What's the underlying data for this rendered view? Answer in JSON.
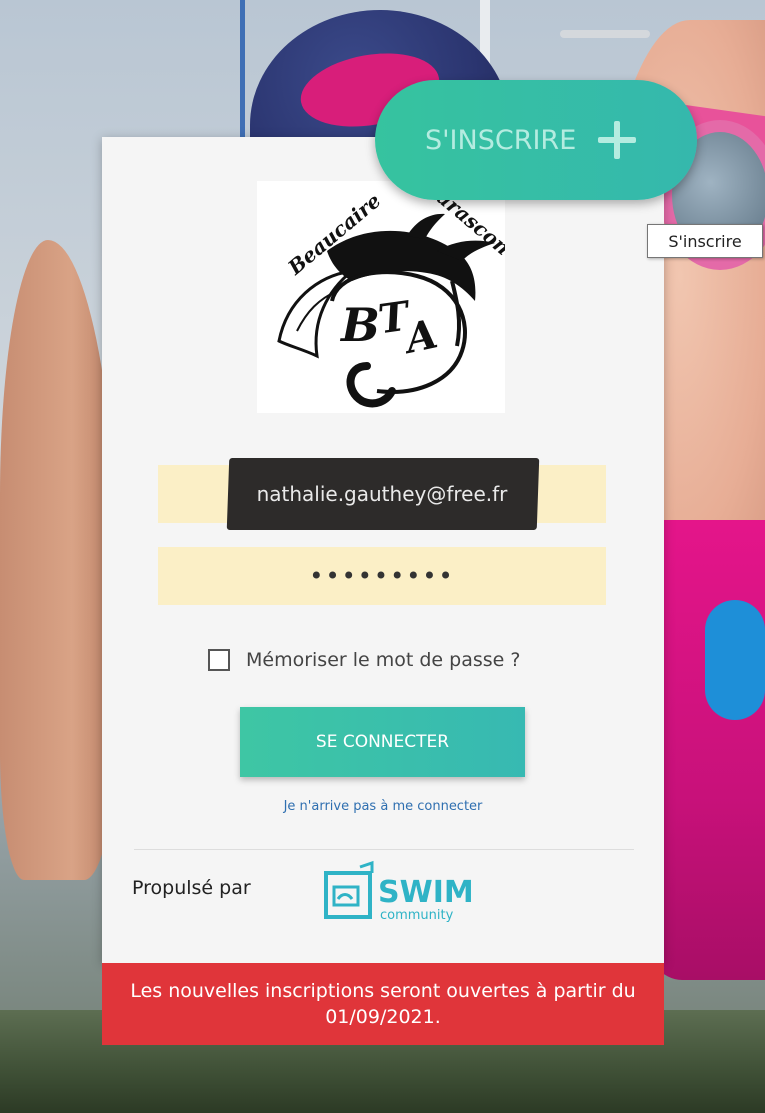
{
  "signup": {
    "label": "S'INSCRIRE",
    "tooltip": "S'inscrire"
  },
  "club_logo": {
    "text_left": "Beaucaire",
    "text_right": "Tarascon",
    "initials": "BTA"
  },
  "login": {
    "email_value": "nathalie.gauthey@free.fr",
    "password_mask": "•••••••••",
    "remember_label": "Mémoriser le mot de passe ?",
    "connect_label": "SE CONNECTER",
    "forgot_link": "Je n'arrive pas à me connecter"
  },
  "footer": {
    "powered_by": "Propulsé par",
    "brand_name": "SWIM",
    "brand_sub": "community"
  },
  "notice": {
    "text": "Les nouvelles inscriptions seront ouvertes à partir du 01/09/2021."
  },
  "colors": {
    "accent": "#36c39f",
    "notice": "#e0353a",
    "field_bg": "#fbefc6",
    "link": "#2f6fb0"
  }
}
